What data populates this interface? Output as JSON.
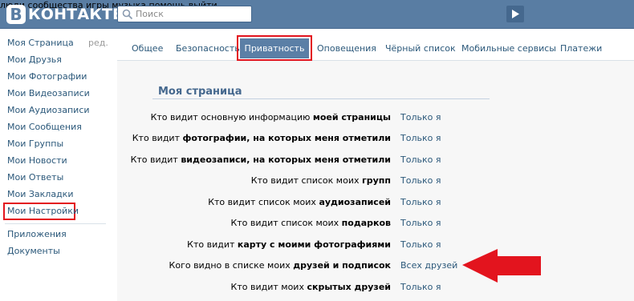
{
  "header": {
    "logo_badge": "B",
    "logo_text": "КОНТАКТЕ",
    "search_placeholder": "Поиск",
    "nav": [
      "люди",
      "сообщества",
      "игры",
      "музыка",
      "помощь",
      "выйти"
    ]
  },
  "sidebar": {
    "items": [
      "Моя Страница",
      "Мои Друзья",
      "Мои Фотографии",
      "Мои Видеозаписи",
      "Мои Аудиозаписи",
      "Мои Сообщения",
      "Мои Группы",
      "Мои Новости",
      "Мои Ответы",
      "Мои Закладки",
      "Мои Настройки"
    ],
    "edit_label": "ред.",
    "extra_items": [
      "Приложения",
      "Документы"
    ]
  },
  "tabs": [
    "Общее",
    "Безопасность",
    "Приватность",
    "Оповещения",
    "Чёрный список",
    "Мобильные сервисы",
    "Платежи"
  ],
  "section_title": "Моя страница",
  "rows": [
    {
      "prefix": "Кто видит основную информацию ",
      "bold": "моей страницы",
      "value": "Только я"
    },
    {
      "prefix": "Кто видит ",
      "bold": "фотографии, на которых меня отметили",
      "value": "Только я"
    },
    {
      "prefix": "Кто видит ",
      "bold": "видеозаписи, на которых меня отметили",
      "value": "Только я"
    },
    {
      "prefix": "Кто видит список моих ",
      "bold": "групп",
      "value": "Только я"
    },
    {
      "prefix": "Кто видит список моих ",
      "bold": "аудиозаписей",
      "value": "Только я"
    },
    {
      "prefix": "Кто видит список моих ",
      "bold": "подарков",
      "value": "Только я"
    },
    {
      "prefix": "Кто видит ",
      "bold": "карту с моими фотографиями",
      "value": "Только я"
    },
    {
      "prefix": "Кого видно в списке моих ",
      "bold": "друзей и подписок",
      "value": "Всех друзей"
    },
    {
      "prefix": "Кто видит моих ",
      "bold": "скрытых друзей",
      "value": "Только я"
    }
  ],
  "colors": {
    "header_bg": "#597da3",
    "link": "#2b587a",
    "active_tab": "#5b7fa6",
    "highlight_red": "#e3141e"
  }
}
